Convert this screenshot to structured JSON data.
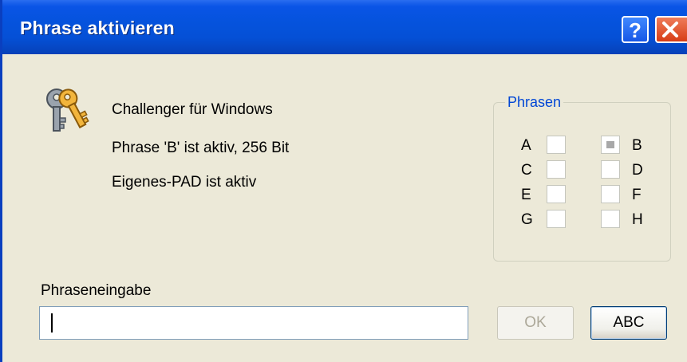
{
  "window": {
    "title": "Phrase aktivieren",
    "help_icon": "question-mark-icon",
    "close_icon": "close-x-icon"
  },
  "info": {
    "icon": "keys-icon",
    "line1": "Challenger für Windows",
    "line2": "Phrase 'B' ist aktiv, 256 Bit",
    "line3": "Eigenes-PAD ist aktiv"
  },
  "phrasen": {
    "legend": "Phrasen",
    "items": [
      {
        "label": "A",
        "checked": false
      },
      {
        "label": "B",
        "checked": true
      },
      {
        "label": "C",
        "checked": false
      },
      {
        "label": "D",
        "checked": false
      },
      {
        "label": "E",
        "checked": false
      },
      {
        "label": "F",
        "checked": false
      },
      {
        "label": "G",
        "checked": false
      },
      {
        "label": "H",
        "checked": false
      }
    ]
  },
  "input": {
    "label": "Phraseneingabe",
    "value": ""
  },
  "buttons": {
    "ok": "OK",
    "abc": "ABC"
  },
  "colors": {
    "titlebar": "#0553dd",
    "dialog_bg": "#ece9d8",
    "legend_text": "#0046d5",
    "close_button": "#d73d16"
  }
}
